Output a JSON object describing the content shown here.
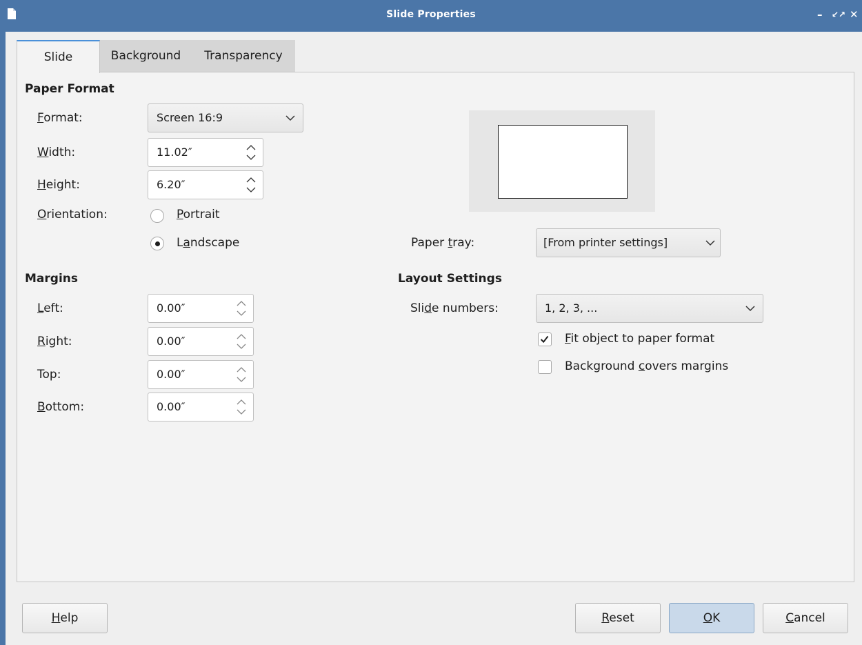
{
  "window": {
    "title": "Slide Properties",
    "controls": {
      "minimize": "–",
      "restore": "↙↗",
      "close": "✕"
    }
  },
  "tabs": [
    {
      "label": "Slide",
      "active": true
    },
    {
      "label": "Background",
      "active": false
    },
    {
      "label": "Transparency",
      "active": false
    }
  ],
  "paper_format": {
    "heading": "Paper Format",
    "format": {
      "label_pre": "",
      "label_u": "F",
      "label_post": "ormat:",
      "value": "Screen 16:9"
    },
    "width": {
      "label_pre": "",
      "label_u": "W",
      "label_post": "idth:",
      "value": "11.02″"
    },
    "height": {
      "label_pre": "",
      "label_u": "H",
      "label_post": "eight:",
      "value": "6.20″"
    },
    "orientation": {
      "label_pre": "",
      "label_u": "O",
      "label_post": "rientation:",
      "portrait": {
        "pre": "",
        "u": "P",
        "post": "ortrait",
        "selected": false
      },
      "landscape": {
        "pre": "L",
        "u": "a",
        "post": "ndscape",
        "selected": true
      }
    },
    "paper_tray": {
      "label_pre": "Paper ",
      "label_u": "t",
      "label_post": "ray:",
      "value": "[From printer settings]"
    }
  },
  "margins": {
    "heading": "Margins",
    "left": {
      "label_pre": "",
      "label_u": "L",
      "label_post": "eft:",
      "value": "0.00″"
    },
    "right": {
      "label_pre": "",
      "label_u": "R",
      "label_post": "ight:",
      "value": "0.00″"
    },
    "top": {
      "label_pre": "Top:",
      "label_u": "",
      "label_post": "",
      "value": "0.00″"
    },
    "bottom": {
      "label_pre": "",
      "label_u": "B",
      "label_post": "ottom:",
      "value": "0.00″"
    }
  },
  "layout_settings": {
    "heading": "Layout Settings",
    "slide_numbers": {
      "label_pre": "Sli",
      "label_u": "d",
      "label_post": "e numbers:",
      "value": "1, 2, 3, ..."
    },
    "fit_object": {
      "pre": "",
      "u": "F",
      "post": "it object to paper format",
      "checked": true
    },
    "background_covers": {
      "pre": "Background ",
      "u": "c",
      "post": "overs margins",
      "checked": false
    }
  },
  "buttons": {
    "help": {
      "pre": "",
      "u": "H",
      "post": "elp"
    },
    "reset": {
      "pre": "",
      "u": "R",
      "post": "eset"
    },
    "ok": {
      "pre": "",
      "u": "O",
      "post": "K"
    },
    "cancel": {
      "pre": "",
      "u": "C",
      "post": "ancel"
    }
  },
  "colors": {
    "titlebar": "#4b76a8",
    "accent": "#4a90d9",
    "default_button": "#c9d9ea"
  },
  "icons": {
    "window": "document-icon",
    "spin": "spin-arrows-icon",
    "dropdown": "chevron-down-icon",
    "check": "checkmark-icon"
  }
}
